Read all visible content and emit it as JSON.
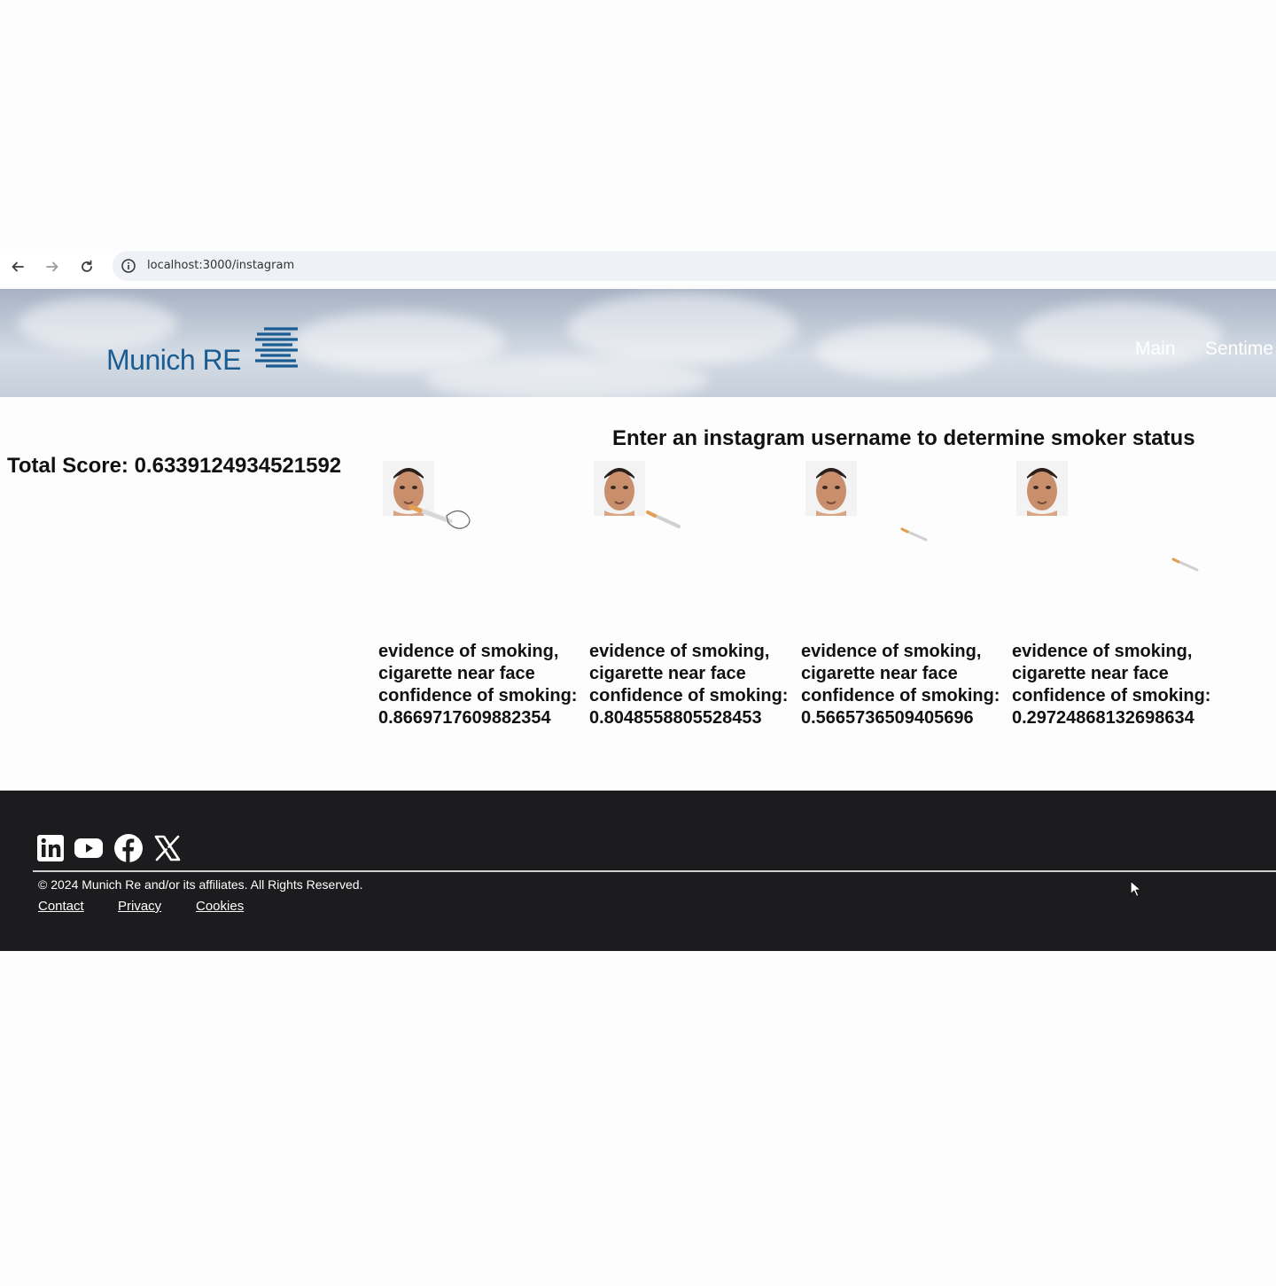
{
  "browser": {
    "url": "localhost:3000/instagram"
  },
  "header": {
    "logo_text": "Munich RE",
    "nav": [
      {
        "label": "Main"
      },
      {
        "label": "Sentime"
      }
    ]
  },
  "main": {
    "heading": "Enter an instagram username to determine smoker status",
    "total_score_label": "Total Score: ",
    "total_score_value": "0.6339124934521592",
    "results": [
      {
        "text": "evidence of smoking, cigarette near face confidence of smoking:",
        "value": "0.8669717609882354"
      },
      {
        "text": "evidence of smoking, cigarette near face confidence of smoking:",
        "value": "0.8048558805528453"
      },
      {
        "text": "evidence of smoking, cigarette near face confidence of smoking:",
        "value": "0.5665736509405696"
      },
      {
        "text": "evidence of smoking, cigarette near face confidence of smoking:",
        "value": "0.29724868132698634"
      }
    ]
  },
  "footer": {
    "social_icons": [
      "linkedin-icon",
      "youtube-icon",
      "facebook-icon",
      "x-icon"
    ],
    "copyright": "© 2024 Munich Re and/or its affiliates. All Rights Reserved.",
    "links": [
      {
        "label": "Contact"
      },
      {
        "label": "Privacy"
      },
      {
        "label": "Cookies"
      }
    ]
  },
  "colors": {
    "brand_blue": "#1b5d93",
    "footer_bg": "#1c1c1e",
    "address_bar_bg": "#eef1f6"
  }
}
